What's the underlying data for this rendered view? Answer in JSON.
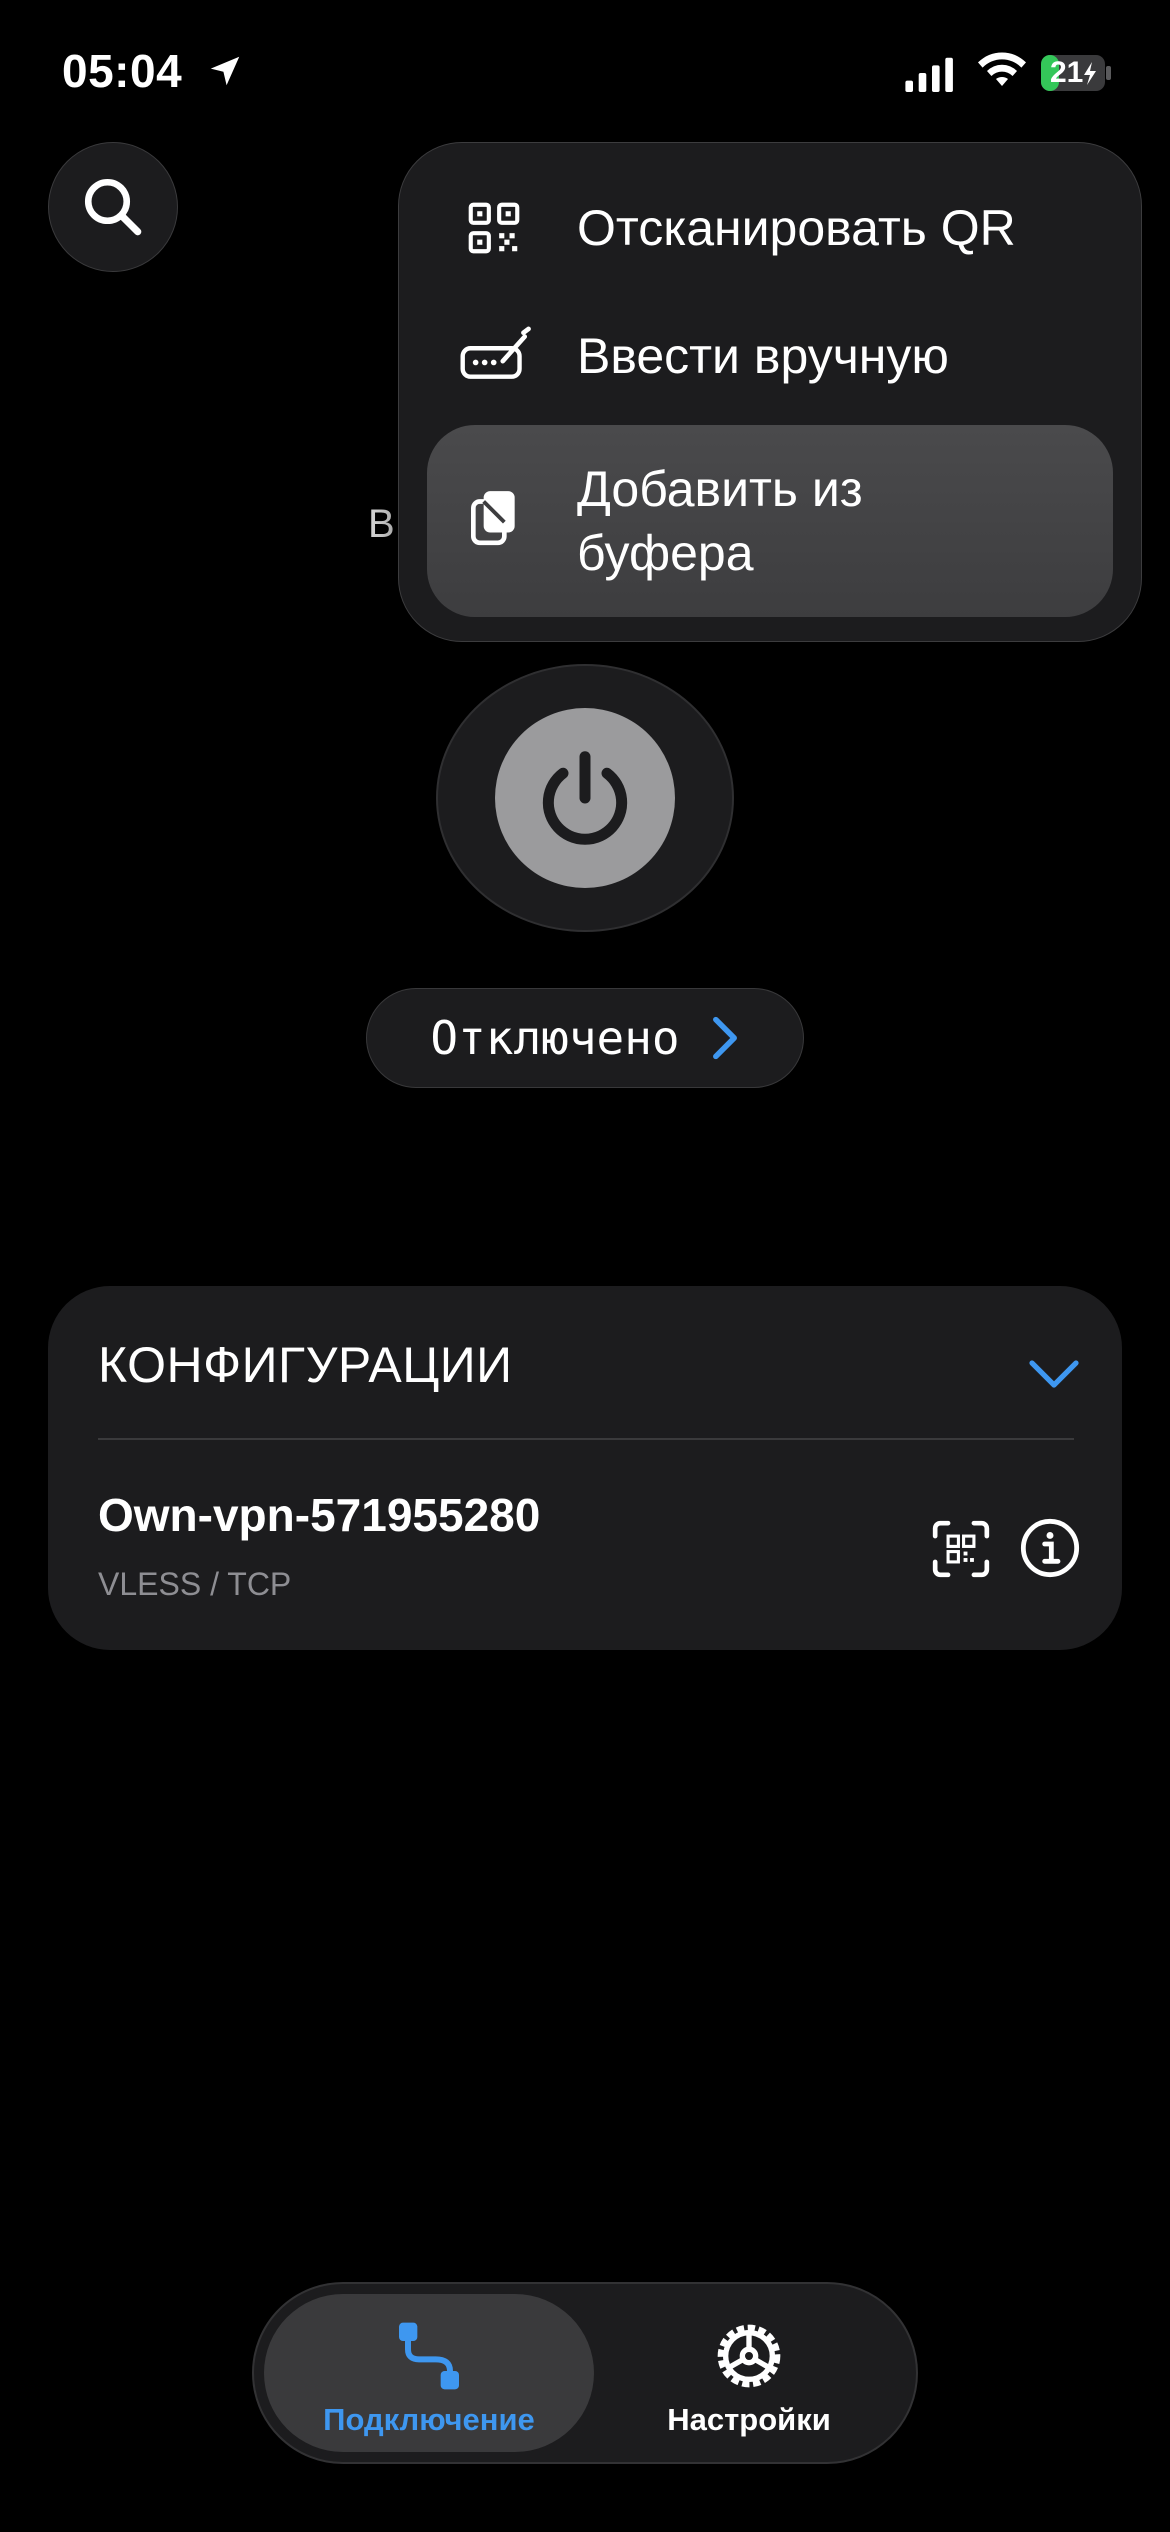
{
  "status_bar": {
    "time": "05:04",
    "battery": "21"
  },
  "background_fragment": "В",
  "menu": {
    "items": [
      {
        "icon": "qr-scan-icon",
        "label": "Отсканировать QR"
      },
      {
        "icon": "manual-input-icon",
        "label": "Ввести вручную"
      },
      {
        "icon": "clipboard-icon",
        "label_line1": "Добавить из",
        "label_line2": "буфера"
      }
    ]
  },
  "connection": {
    "status_label": "Отключено"
  },
  "configurations": {
    "title": "КОНФИГУРАЦИИ",
    "items": [
      {
        "name": "Own-vpn-571955280",
        "protocol": "VLESS / TCP"
      }
    ]
  },
  "tabbar": {
    "tabs": [
      {
        "icon": "connection-icon",
        "label": "Подключение",
        "active": true
      },
      {
        "icon": "settings-icon",
        "label": "Настройки",
        "active": false
      }
    ]
  },
  "colors": {
    "accent": "#3e97f0",
    "background": "#000000",
    "card": "#1c1c1e",
    "power_button": "#9b9b9d"
  }
}
